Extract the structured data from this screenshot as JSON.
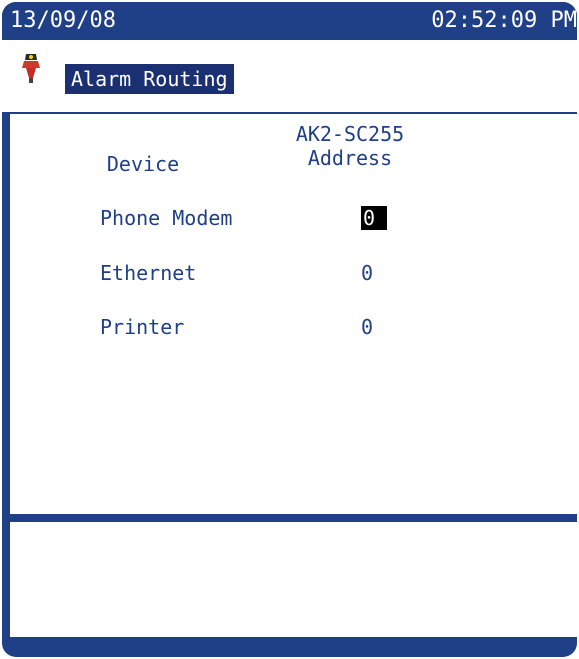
{
  "status_bar": {
    "date": "13/09/08",
    "time": "02:52:09 PM"
  },
  "screen": {
    "title": "Alarm Routing",
    "icon": "alarm-routing-icon"
  },
  "table": {
    "headers": {
      "device": "Device",
      "address_line1": "AK2-SC255",
      "address_line2": "Address"
    },
    "rows": [
      {
        "device": "Phone Modem",
        "address": "0",
        "selected": true
      },
      {
        "device": "Ethernet",
        "address": "0",
        "selected": false
      },
      {
        "device": "Printer",
        "address": "0",
        "selected": false
      }
    ]
  },
  "colors": {
    "frame": "#1f3f86",
    "text": "#1f3f86",
    "title_bg": "#1b2f73",
    "selection_bg": "#000000"
  }
}
